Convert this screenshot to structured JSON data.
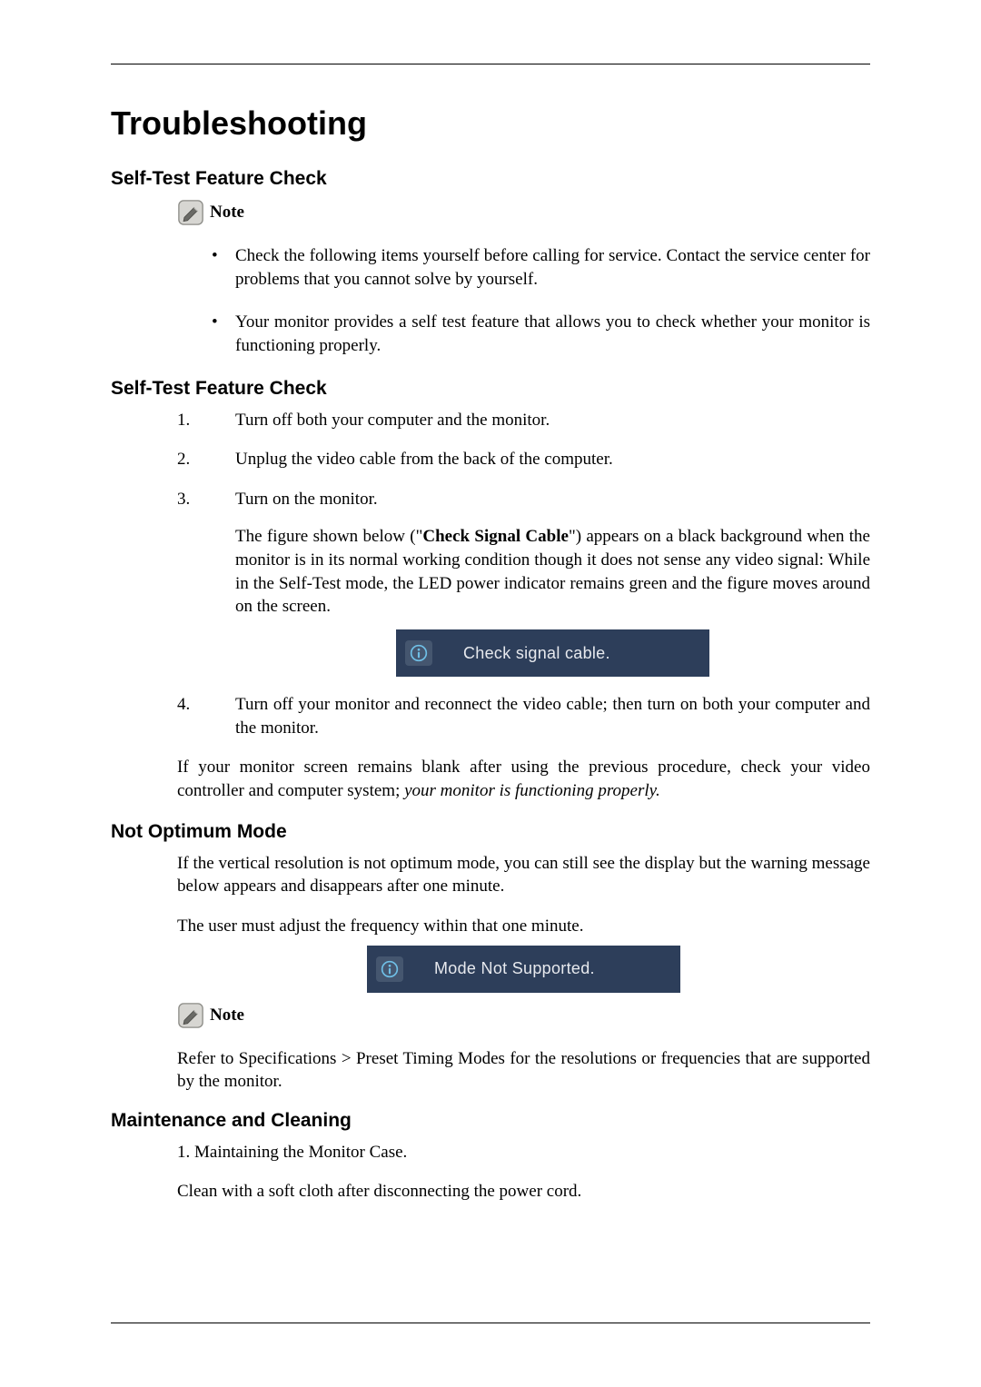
{
  "doc": {
    "title": "Troubleshooting",
    "sections": {
      "s1": {
        "heading": "Self-Test Feature Check",
        "note_label": "Note",
        "bullets": [
          "Check the following items yourself before calling for service. Contact the service center for problems that you cannot solve by yourself.",
          "Your monitor provides a self test feature that allows you to check whether your monitor is functioning properly."
        ]
      },
      "s2": {
        "heading": "Self-Test Feature Check",
        "steps": {
          "n1": "1.",
          "t1": "Turn off both your computer and the monitor.",
          "n2": "2.",
          "t2": "Unplug the video cable from the back of the computer.",
          "n3": "3.",
          "t3": "Turn on the monitor.",
          "t3_extra_pre": "The figure shown below (\"",
          "t3_extra_bold": "Check Signal Cable",
          "t3_extra_post": "\") appears on a black background when the monitor is in its normal working condition though it does not sense any video signal: While in the Self-Test mode, the LED power indicator remains green and the figure moves around on the screen.",
          "n4": "4.",
          "t4": "Turn off your monitor and reconnect the video cable; then turn on both your computer and the monitor."
        },
        "msg1": "Check signal cable.",
        "after_pre": "If your monitor screen remains blank after using the previous procedure, check your video controller and computer system; ",
        "after_ital": "your monitor is functioning properly."
      },
      "s3": {
        "heading": "Not Optimum Mode",
        "p1": "If the vertical resolution is not optimum mode, you can still see the display but the warning message below appears and disappears after one minute.",
        "p2": "The user must adjust the frequency within that one minute.",
        "msg2": "Mode Not Supported.",
        "note_label": "Note",
        "note_text": "Refer to Specifications > Preset Timing Modes for the resolutions or frequencies that are supported by the monitor."
      },
      "s4": {
        "heading": "Maintenance and Cleaning",
        "p1": "1. Maintaining the Monitor Case.",
        "p2": "Clean with a soft cloth after disconnecting the power cord."
      }
    }
  }
}
